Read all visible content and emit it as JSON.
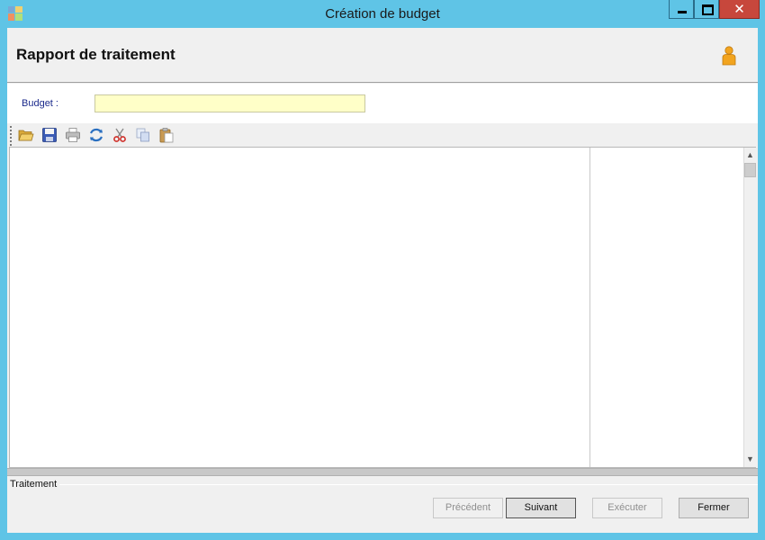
{
  "window": {
    "title": "Création de budget",
    "close_glyph": "✕"
  },
  "header": {
    "title": "Rapport de traitement",
    "icon": "user-icon"
  },
  "form": {
    "budget_label": "Budget :",
    "budget_value": ""
  },
  "toolbar": {
    "buttons": [
      "open-folder-icon",
      "save-icon",
      "print-icon",
      "refresh-icon",
      "cut-icon",
      "copy-icon",
      "paste-icon"
    ]
  },
  "scroll": {
    "up_glyph": "▲",
    "down_glyph": "▼"
  },
  "status": {
    "label": "Traitement"
  },
  "buttons": {
    "previous": "Précédent",
    "next": "Suivant",
    "execute": "Exécuter",
    "close": "Fermer"
  },
  "colors": {
    "window_frame": "#5fc4e6",
    "input_background": "#ffffc8",
    "close_button": "#c7473c"
  }
}
